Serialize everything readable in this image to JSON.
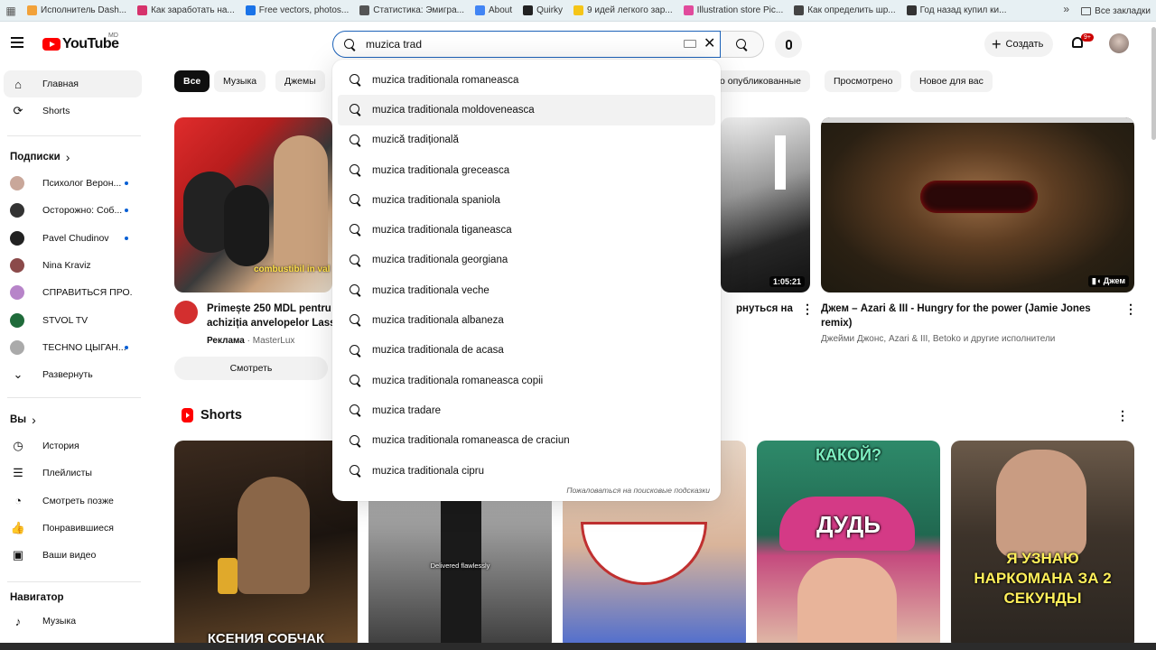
{
  "bookmarks": {
    "items": [
      {
        "label": "Исполнитель Dash...",
        "color": "#f2a23a"
      },
      {
        "label": "Как заработать на...",
        "color": "#d6336c"
      },
      {
        "label": "Free vectors, photos...",
        "color": "#1a73e8"
      },
      {
        "label": "Статистика: Эмигра...",
        "color": "#555555"
      },
      {
        "label": "About",
        "color": "#4285f4"
      },
      {
        "label": "Quirky",
        "color": "#222222"
      },
      {
        "label": "9 идей легкого зар...",
        "color": "#f5c518"
      },
      {
        "label": "Illustration store Pic...",
        "color": "#e14b9c"
      },
      {
        "label": "Как определить шр...",
        "color": "#444444"
      },
      {
        "label": "Год назад купил ки...",
        "color": "#333333"
      }
    ],
    "more": "»",
    "all_label": "Все закладки"
  },
  "header": {
    "logo_text": "YouTube",
    "region": "MD",
    "search_value": "muzica trad",
    "create_label": "Создать",
    "notifications_badge": "9+"
  },
  "sidebar": {
    "main": [
      {
        "label": "Главная",
        "icon": "home-icon",
        "active": true
      },
      {
        "label": "Shorts",
        "icon": "shorts-icon",
        "active": false
      }
    ],
    "subscriptions_title": "Подписки",
    "subscriptions": [
      {
        "label": "Психолог Верон...",
        "color": "#c9a79a",
        "live": true
      },
      {
        "label": "Осторожно: Соб...",
        "color": "#333333",
        "live": true
      },
      {
        "label": "Pavel Chudinov",
        "color": "#222222",
        "live": true
      },
      {
        "label": "Nina Kraviz",
        "color": "#8b4a4a",
        "live": false
      },
      {
        "label": "СПРАВИТЬСЯ ПРО...",
        "color": "#b784c9",
        "live": false
      },
      {
        "label": "STVOL TV",
        "color": "#1f6b3a",
        "live": false
      },
      {
        "label": "TECHNO ЦЫГАН...",
        "color": "#aaaaaa",
        "live": true
      }
    ],
    "expand_label": "Развернуть",
    "you_title": "Вы",
    "you_items": [
      {
        "label": "История",
        "icon": "history-icon"
      },
      {
        "label": "Плейлисты",
        "icon": "playlists-icon"
      },
      {
        "label": "Смотреть позже",
        "icon": "watch-later-icon"
      },
      {
        "label": "Понравившиеся",
        "icon": "like-icon"
      },
      {
        "label": "Ваши видео",
        "icon": "your-videos-icon"
      }
    ],
    "navigator_title": "Навигатор",
    "navigator_items": [
      {
        "label": "Музыка",
        "icon": "music-icon"
      }
    ]
  },
  "chips": [
    "Все",
    "Музыка",
    "Джемы",
    "о опубликованные",
    "Просмотрено",
    "Новое для вас"
  ],
  "videos": [
    {
      "title_line1": "Primește 250 MDL pentru",
      "title_line2": "achiziția anvelopelor Lass",
      "ad_label": "Реклама",
      "channel": "MasterLux",
      "cta": "Смотреть",
      "overlay": "combustibil in val"
    },
    {
      "duration": "1:05:21",
      "title_fragment": "рнуться на"
    },
    {
      "title_line1": "Джем – Azari & III - Hungry for the power (Jamie Jones",
      "title_line2": "remix)",
      "meta": "Джейми Джонс, Azari & III, Betoko и другие исполнители",
      "badge": "Джем"
    }
  ],
  "shorts": {
    "title": "Shorts",
    "items": [
      {
        "caption": "КСЕНИЯ СОБЧАК"
      },
      {
        "caption": "Delivered flawlessly"
      },
      {
        "caption": ""
      },
      {
        "caption": "ДУДЬ",
        "top": "КАКОЙ?"
      },
      {
        "caption": "Я УЗНАЮ НАРКОМАНА ЗА 2 СЕКУНДЫ"
      }
    ]
  },
  "suggestions": {
    "items": [
      "muzica traditionala romaneasca",
      "muzica traditionala moldoveneasca",
      "muzică tradițională",
      "muzica traditionala greceasca",
      "muzica traditionala spaniola",
      "muzica traditionala tiganeasca",
      "muzica traditionala georgiana",
      "muzica traditionala veche",
      "muzica traditionala albaneza",
      "muzica traditionala de acasa",
      "muzica traditionala romaneasca copii",
      "muzica tradare",
      "muzica traditionala romaneasca de craciun",
      "muzica traditionala cipru"
    ],
    "hover_index": 1,
    "report_label": "Пожаловаться на поисковые подсказки"
  }
}
